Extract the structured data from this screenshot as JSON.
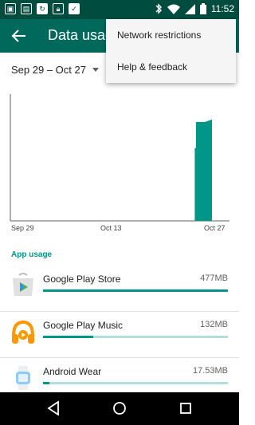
{
  "status_bar": {
    "time": "11:52",
    "notification_icons": [
      "image-icon",
      "gallery-icon",
      "sync-icon",
      "lock-icon",
      "mail-check-icon"
    ],
    "system_icons": [
      "bluetooth-icon",
      "wifi-icon",
      "signal-icon",
      "battery-icon"
    ]
  },
  "app_bar": {
    "title": "Data usag",
    "back_icon": "arrow-back-icon"
  },
  "cycle": {
    "label": "Sep 29 – Oct 27"
  },
  "chart_data": {
    "type": "area",
    "title": "",
    "x_tick_labels": [
      "Sep 29",
      "Oct 13",
      "Oct 27"
    ],
    "x": [
      "Sep 29",
      "Sep 30",
      "Oct 1",
      "Oct 2",
      "Oct 3",
      "Oct 4",
      "Oct 5",
      "Oct 6",
      "Oct 7",
      "Oct 8",
      "Oct 9",
      "Oct 10",
      "Oct 11",
      "Oct 12",
      "Oct 13",
      "Oct 14",
      "Oct 15",
      "Oct 16",
      "Oct 17",
      "Oct 18",
      "Oct 19",
      "Oct 20",
      "Oct 21",
      "Oct 22",
      "Oct 23",
      "Oct 24",
      "Oct 25",
      "Oct 26",
      "Oct 27"
    ],
    "series": [
      {
        "values": [
          0,
          0,
          0,
          0,
          0,
          0,
          0,
          0,
          0,
          0,
          0,
          0,
          0,
          0,
          0,
          0,
          0,
          0,
          0,
          0,
          0,
          0,
          0,
          0,
          0,
          0,
          0.62,
          0.8,
          0.82
        ]
      }
    ],
    "ylim": [
      0,
      1
    ],
    "color": "#009688",
    "grid": false
  },
  "section": {
    "header": "App usage"
  },
  "apps": [
    {
      "name": "Google Play Store",
      "size": "477MB",
      "fraction": 1.0,
      "icon": "play-store-icon"
    },
    {
      "name": "Google Play Music",
      "size": "132MB",
      "fraction": 0.27,
      "icon": "headphones-icon"
    },
    {
      "name": "Android Wear",
      "size": "17.53MB",
      "fraction": 0.035,
      "icon": "watch-icon"
    }
  ],
  "menu": {
    "items": [
      "Network restrictions",
      "Help & feedback"
    ]
  },
  "nav_bar": {
    "buttons": [
      "back-triangle-icon",
      "home-circle-icon",
      "recents-square-icon"
    ]
  },
  "colors": {
    "status_bar": "#004d40",
    "app_bar": "#00695c",
    "accent": "#009688",
    "bar_track": "#b2dfdb"
  }
}
